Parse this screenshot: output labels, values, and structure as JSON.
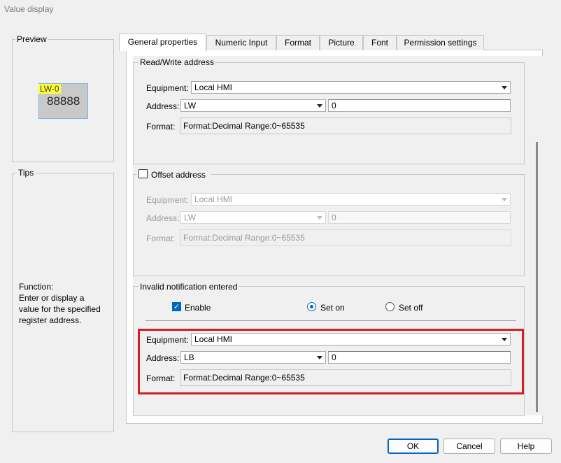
{
  "window": {
    "title": "Value display"
  },
  "preview": {
    "label": "Preview",
    "tag": "LW-0",
    "digits": "88888"
  },
  "tips": {
    "label": "Tips",
    "function_heading": "Function:",
    "line1": "Enter or display a",
    "line2": "value for the specified",
    "line3": "register address."
  },
  "tabs": [
    {
      "label": "General properties"
    },
    {
      "label": "Numeric Input"
    },
    {
      "label": "Format"
    },
    {
      "label": "Picture"
    },
    {
      "label": "Font"
    },
    {
      "label": "Permission settings"
    }
  ],
  "rw": {
    "title": "Read/Write address",
    "equipment_label": "Equipment:",
    "equipment_value": "Local HMI",
    "address_label": "Address:",
    "address_type": "LW",
    "address_value": "0",
    "format_label": "Format:",
    "format_value": "Format:Decimal  Range:0~65535"
  },
  "offset": {
    "title": "Offset address",
    "checked": false,
    "equipment_label": "Equipment:",
    "equipment_value": "Local HMI",
    "address_label": "Address:",
    "address_type": "LW",
    "address_value": "0",
    "format_label": "Format:",
    "format_value": "Format:Decimal  Range:0~65535"
  },
  "invalid": {
    "title": "Invalid notification entered",
    "enable_label": "Enable",
    "enable_checked": true,
    "set_on_label": "Set on",
    "set_off_label": "Set off",
    "selected": "Set on",
    "equipment_label": "Equipment:",
    "equipment_value": "Local HMI",
    "address_label": "Address:",
    "address_type": "LB",
    "address_value": "0",
    "format_label": "Format:",
    "format_value": "Format:Decimal  Range:0~65535"
  },
  "buttons": {
    "ok": "OK",
    "cancel": "Cancel",
    "help": "Help"
  },
  "colors": {
    "accent": "#0067c0",
    "highlight_border": "#d32027",
    "tag_bg": "#ffff35"
  }
}
